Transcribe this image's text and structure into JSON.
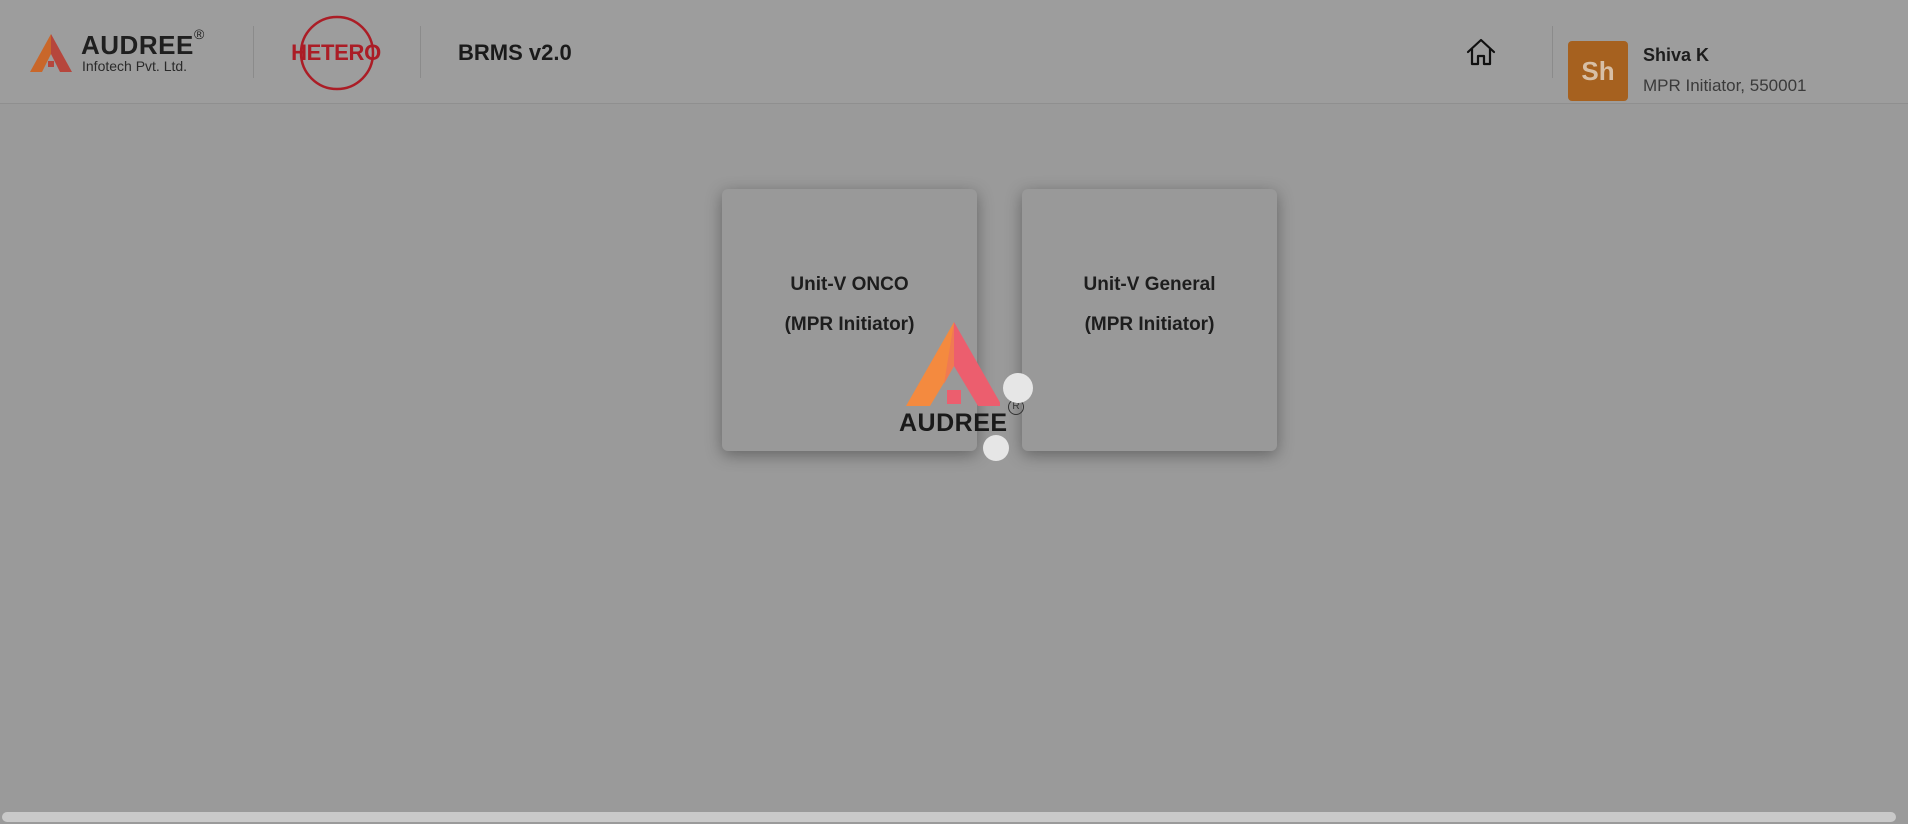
{
  "brand": {
    "name": "AUDREE",
    "registered": "®",
    "subtitle": "Infotech Pvt. Ltd.",
    "colors": {
      "orange": "#e37a2e",
      "red": "#b83b4a"
    }
  },
  "partner_logo": {
    "text": "HETERO",
    "color": "#ab1d26"
  },
  "app": {
    "title": "BRMS v2.0"
  },
  "header": {
    "home_icon": "home-icon"
  },
  "user": {
    "initials": "Sh",
    "name": "Shiva K",
    "role": "MPR Initiator, 550001",
    "avatar_color": "#a6611f"
  },
  "units": [
    {
      "title": "Unit-V ONCO",
      "subtitle": "(MPR Initiator)"
    },
    {
      "title": "Unit-V General",
      "subtitle": "(MPR Initiator)"
    }
  ],
  "loader": {
    "word": "AUDREE",
    "registered": "R",
    "colors": {
      "orange": "#f48a3f",
      "pink": "#ec5e6e"
    }
  }
}
